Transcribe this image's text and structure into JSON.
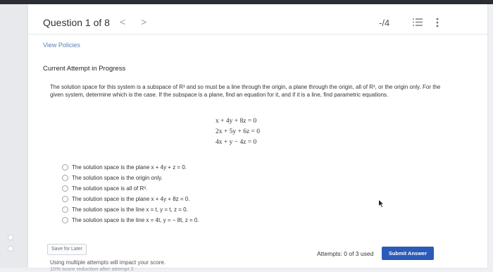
{
  "question": {
    "title": "Question 1 of 8",
    "prev_glyph": "<",
    "next_glyph": ">",
    "score": "-/4"
  },
  "links": {
    "view_policies": "View Policies"
  },
  "attempt": {
    "heading": "Current Attempt in Progress"
  },
  "prompt": "The solution space for this system is a subspace of R³ and so must be a line through the origin, a plane through the origin, all of R³, or the origin only. For the given system, determine which is the case. If the subspace is a plane, find an equation for it, and if it is a line, find parametric equations.",
  "equations": [
    "x + 4y + 8z = 0",
    "2x + 5y + 6z = 0",
    "4x + y − 4z = 0"
  ],
  "options": [
    "The solution space is the plane x + 4y + z = 0.",
    "The solution space is the origin only.",
    "The solution space is all of R³.",
    "The solution space is the plane x + 4y + 8z = 0.",
    "The solution space is the line x = t, y = t, z = 0.",
    "The solution space is the line x = 4t, y = − 8t, z = 0."
  ],
  "footer": {
    "save_for_later": "Save for Later",
    "attempts": "Attempts: 0 of 3 used",
    "submit": "Submit Answer",
    "multiple_attempts_note": "Using multiple attempts will impact your score.",
    "reduction_note": "10% score reduction after attempt 2"
  },
  "colors": {
    "accent": "#2a5bb8",
    "link": "#5b7fb3",
    "topbar": "#2a2d34"
  },
  "icons": [
    "chevron-left-icon",
    "chevron-right-icon",
    "list-icon",
    "more-vertical-icon",
    "cursor-icon"
  ]
}
